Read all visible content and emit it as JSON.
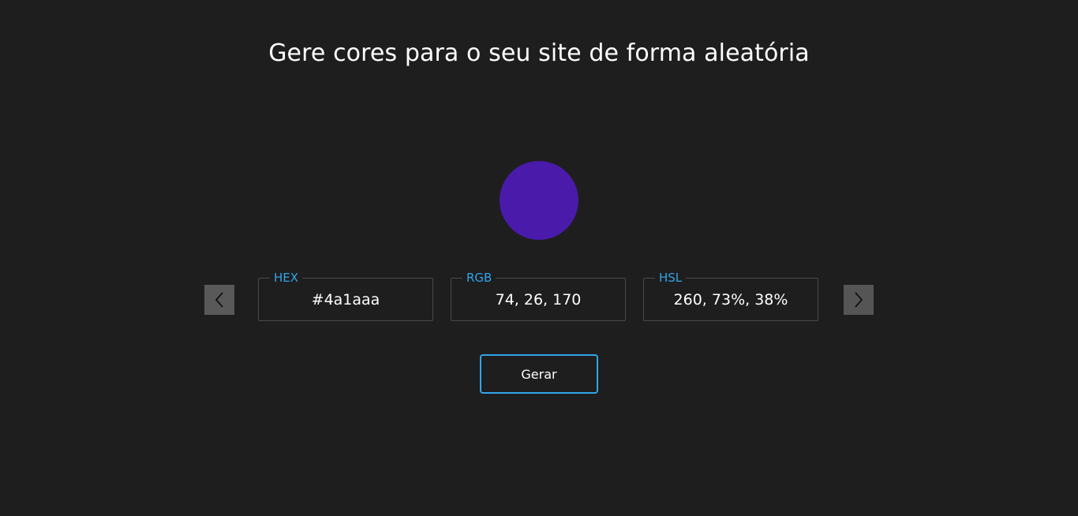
{
  "header": {
    "title": "Gere cores para o seu site de forma aleatória"
  },
  "swatch": {
    "color": "#4a1aaa"
  },
  "fields": {
    "hex": {
      "label": "HEX",
      "value": "#4a1aaa"
    },
    "rgb": {
      "label": "RGB",
      "value": "74, 26, 170"
    },
    "hsl": {
      "label": "HSL",
      "value": "260, 73%, 38%"
    }
  },
  "nav": {
    "prev_icon": "chevron-left-icon",
    "next_icon": "chevron-right-icon"
  },
  "actions": {
    "generate_label": "Gerar"
  },
  "colors": {
    "background": "#1e1e1e",
    "accent": "#33a4e8",
    "arrow_bg": "#595959"
  }
}
